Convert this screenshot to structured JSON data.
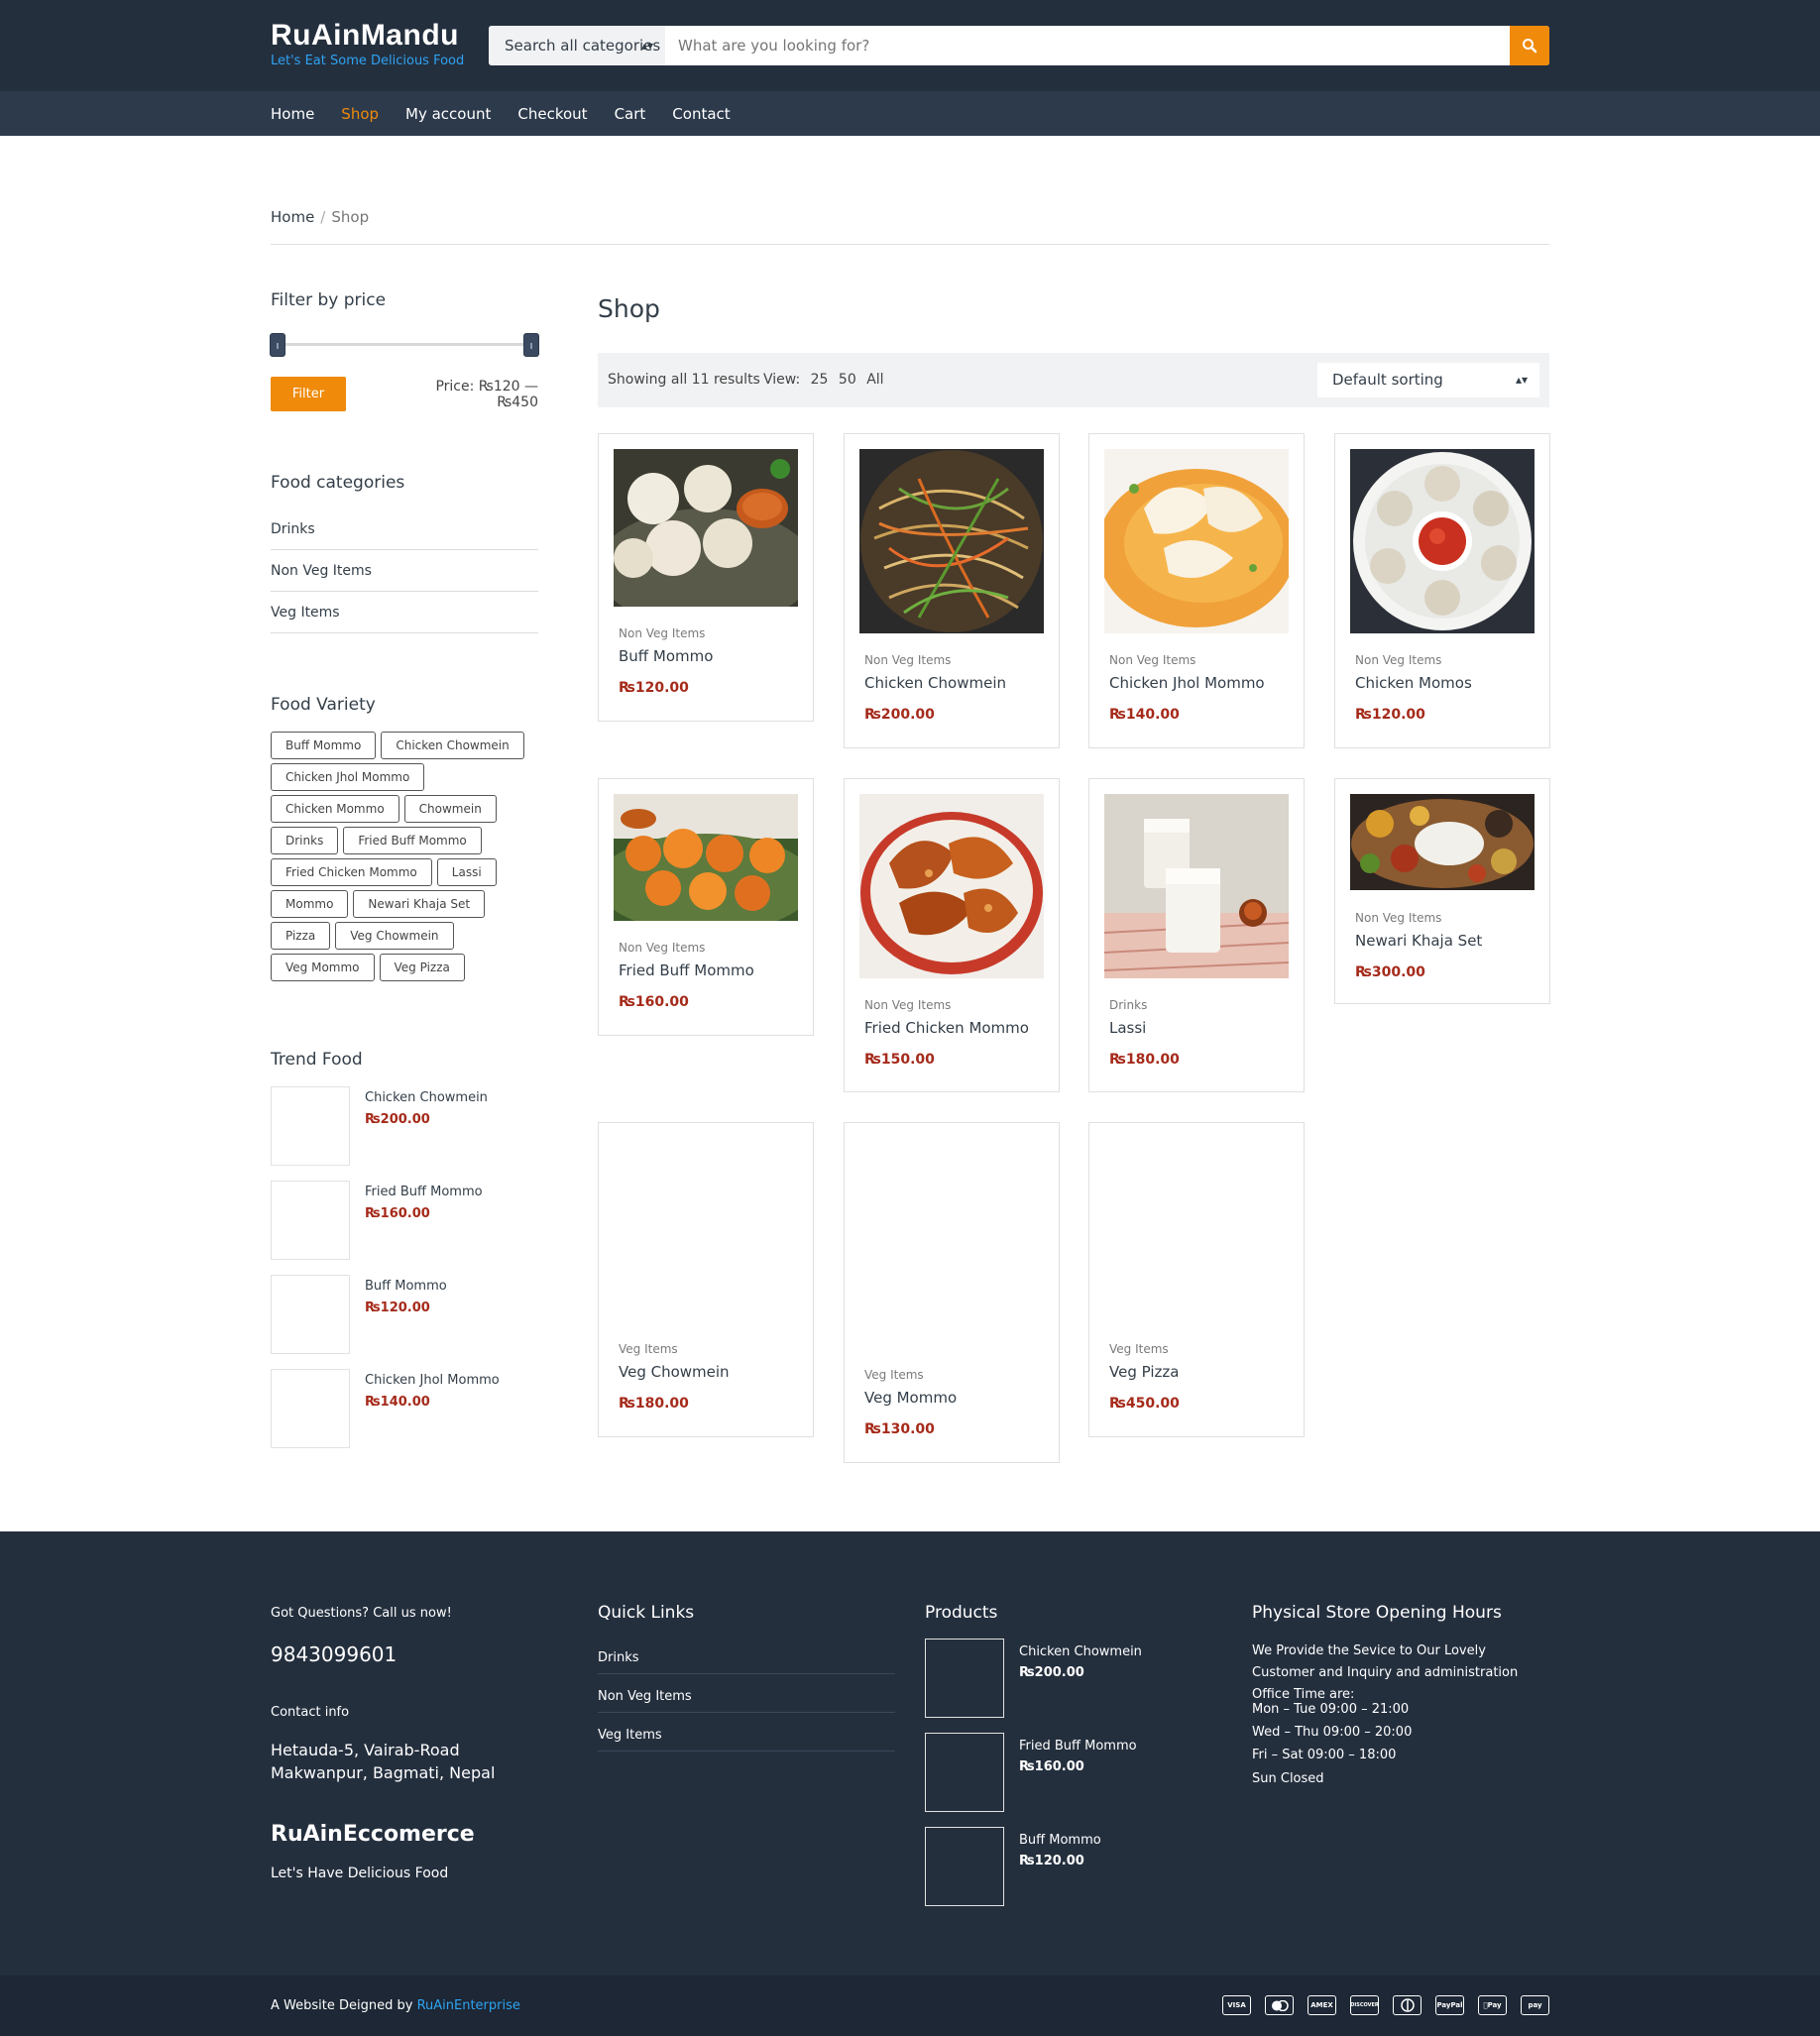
{
  "header": {
    "brand_title": "RuAinMandu",
    "brand_tagline": "Let's Eat Some Delicious Food",
    "search_category": "Search all categories",
    "search_placeholder": "What are you looking for?"
  },
  "nav": [
    "Home",
    "Shop",
    "My account",
    "Checkout",
    "Cart",
    "Contact"
  ],
  "active_nav": "Shop",
  "breadcrumb": {
    "home": "Home",
    "separator": "/",
    "current": "Shop"
  },
  "sidebar": {
    "filter_heading": "Filter by price",
    "filter_button": "Filter",
    "price_label": "Price: ₨120 — ₨450",
    "price_range": {
      "min": 120,
      "max": 450
    },
    "categories_heading": "Food categories",
    "categories": [
      "Drinks",
      "Non Veg Items",
      "Veg Items"
    ],
    "variety_heading": "Food Variety",
    "tags": [
      "Buff Mommo",
      "Chicken Chowmein",
      "Chicken Jhol Mommo",
      "Chicken Mommo",
      "Chowmein",
      "Drinks",
      "Fried Buff Mommo",
      "Fried Chicken Mommo",
      "Lassi",
      "Mommo",
      "Newari Khaja Set",
      "Pizza",
      "Veg Chowmein",
      "Veg Mommo",
      "Veg Pizza"
    ],
    "trend_heading": "Trend Food",
    "trend": [
      {
        "name": "Chicken Chowmein",
        "price": "₨200.00"
      },
      {
        "name": "Fried Buff Mommo",
        "price": "₨160.00"
      },
      {
        "name": "Buff Mommo",
        "price": "₨120.00"
      },
      {
        "name": "Chicken Jhol Mommo",
        "price": "₨140.00"
      }
    ]
  },
  "shop": {
    "title": "Shop",
    "result_count": "Showing all 11 results",
    "view_label": "View:",
    "view_options": [
      "25",
      "50",
      "All"
    ],
    "sorting": "Default sorting",
    "products": [
      {
        "category": "Non Veg Items",
        "name": "Buff Mommo",
        "price": "₨120.00"
      },
      {
        "category": "Non Veg Items",
        "name": "Chicken Chowmein",
        "price": "₨200.00"
      },
      {
        "category": "Non Veg Items",
        "name": "Chicken Jhol Mommo",
        "price": "₨140.00"
      },
      {
        "category": "Non Veg Items",
        "name": "Chicken Momos",
        "price": "₨120.00"
      },
      {
        "category": "Non Veg Items",
        "name": "Fried Buff Mommo",
        "price": "₨160.00"
      },
      {
        "category": "Non Veg Items",
        "name": "Fried Chicken Mommo",
        "price": "₨150.00"
      },
      {
        "category": "Drinks",
        "name": "Lassi",
        "price": "₨180.00"
      },
      {
        "category": "Non Veg Items",
        "name": "Newari Khaja Set",
        "price": "₨300.00"
      },
      {
        "category": "Veg Items",
        "name": "Veg Chowmein",
        "price": "₨180.00"
      },
      {
        "category": "Veg Items",
        "name": "Veg Mommo",
        "price": "₨130.00"
      },
      {
        "category": "Veg Items",
        "name": "Veg Pizza",
        "price": "₨450.00"
      }
    ]
  },
  "footer": {
    "call_heading": "Got Questions? Call us now!",
    "phone": "9843099601",
    "contact_heading": "Contact info",
    "address_line1": "Hetauda-5, Vairab-Road",
    "address_line2": "Makwanpur, Bagmati, Nepal",
    "company": "RuAinEccomerce",
    "company_tagline": "Let's Have Delicious Food",
    "quick_links_heading": "Quick Links",
    "quick_links": [
      "Drinks",
      "Non Veg Items",
      "Veg Items"
    ],
    "products_heading": "Products",
    "products": [
      {
        "name": "Chicken Chowmein",
        "price": "₨200.00"
      },
      {
        "name": "Fried Buff Mommo",
        "price": "₨160.00"
      },
      {
        "name": "Buff Mommo",
        "price": "₨120.00"
      }
    ],
    "hours_heading": "Physical Store Opening Hours",
    "hours_intro": "We Provide the Sevice to Our Lovely Customer and Inquiry and administration Office Time are:",
    "hours": [
      "Mon – Tue 09:00 – 21:00",
      "Wed – Thu 09:00 – 20:00",
      "Fri – Sat 09:00 – 18:00",
      "Sun Closed"
    ],
    "credit_prefix": "A Website Deigned by ",
    "credit_link": "RuAinEnterprise",
    "payment_icons": [
      "VISA",
      "MC",
      "AMEX",
      "DISCOVER",
      "DINERS",
      "PayPal",
      "Apple Pay",
      "Amazon Pay"
    ]
  },
  "colors": {
    "header_bg": "#242f3e",
    "nav_bg": "#2d3a4c",
    "accent": "#ef8a0a",
    "price": "#a52a1a",
    "link_blue": "#2ea3f2"
  }
}
